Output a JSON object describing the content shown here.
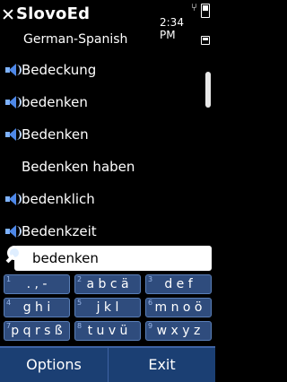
{
  "status_bar": {
    "app_title": "SlovoEd",
    "time": "2:34 PM",
    "icons": [
      "close-icon",
      "usb-icon",
      "battery-icon",
      "signal-icon"
    ]
  },
  "subtitle": "German-Spanish",
  "word_list": [
    {
      "word": "Bedeckung",
      "has_audio": true
    },
    {
      "word": "bedenken",
      "has_audio": true
    },
    {
      "word": "Bedenken",
      "has_audio": true
    },
    {
      "word": "Bedenken haben",
      "has_audio": false
    },
    {
      "word": "bedenklich",
      "has_audio": true
    },
    {
      "word": "Bedenkzeit",
      "has_audio": true
    }
  ],
  "search": {
    "value": "bedenken",
    "icon": "search-icon"
  },
  "keypad": [
    {
      "num": "1",
      "chars": ". , -"
    },
    {
      "num": "2",
      "chars": "a b c ä"
    },
    {
      "num": "3",
      "chars": "d e f"
    },
    {
      "num": "4",
      "chars": "g h i"
    },
    {
      "num": "5",
      "chars": "j k l"
    },
    {
      "num": "6",
      "chars": "m n o ö"
    },
    {
      "num": "7",
      "chars": "p q r s ß"
    },
    {
      "num": "8",
      "chars": "t u v ü"
    },
    {
      "num": "9",
      "chars": "w x y z"
    }
  ],
  "softkeys": {
    "left": "Options",
    "right": "Exit"
  },
  "colors": {
    "background": "#000000",
    "softkey_bar": "#1b3f73",
    "key": "#2f4c7d",
    "speaker_accent": "#4e88e8"
  }
}
